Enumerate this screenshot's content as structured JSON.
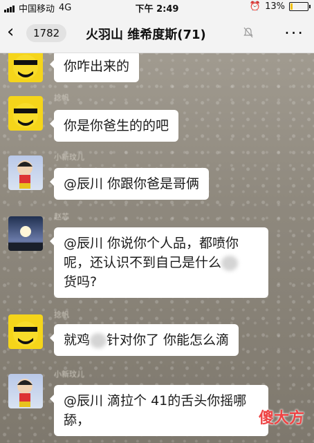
{
  "status_bar": {
    "carrier": "中国移动",
    "network": "4G",
    "time": "下午 2:49",
    "battery": "13%",
    "battery_level": 0.13
  },
  "header": {
    "back_count": "1782",
    "title": "火羽山 维希度斯(71)"
  },
  "messages": [
    {
      "sender": "",
      "text": "你咋出来的",
      "avatar": "yellow-masked-face"
    },
    {
      "sender": "捻帆",
      "text": "你是你爸生的的吧",
      "avatar": "yellow-masked-face"
    },
    {
      "sender": "小新玟儿",
      "text": "@辰川 你跟你爸是哥俩",
      "avatar": "crayon-shin-chan"
    },
    {
      "sender": "赵芯",
      "text_a": "@辰川 你说你个人品，都喷你",
      "text_b": "呢，还认识不到自己是什么",
      "text_c": "货吗?",
      "avatar": "night-sky"
    },
    {
      "sender": "捻帆",
      "text_a": "就鸡",
      "text_b": "针对你了 你能怎么滴",
      "avatar": "yellow-masked-face"
    },
    {
      "sender": "小新玟儿",
      "text_a": "@辰川 滴拉个 41的舌头你摇哪",
      "text_b": "舔，",
      "avatar": "crayon-shin-chan"
    }
  ],
  "watermark": "傻大方"
}
